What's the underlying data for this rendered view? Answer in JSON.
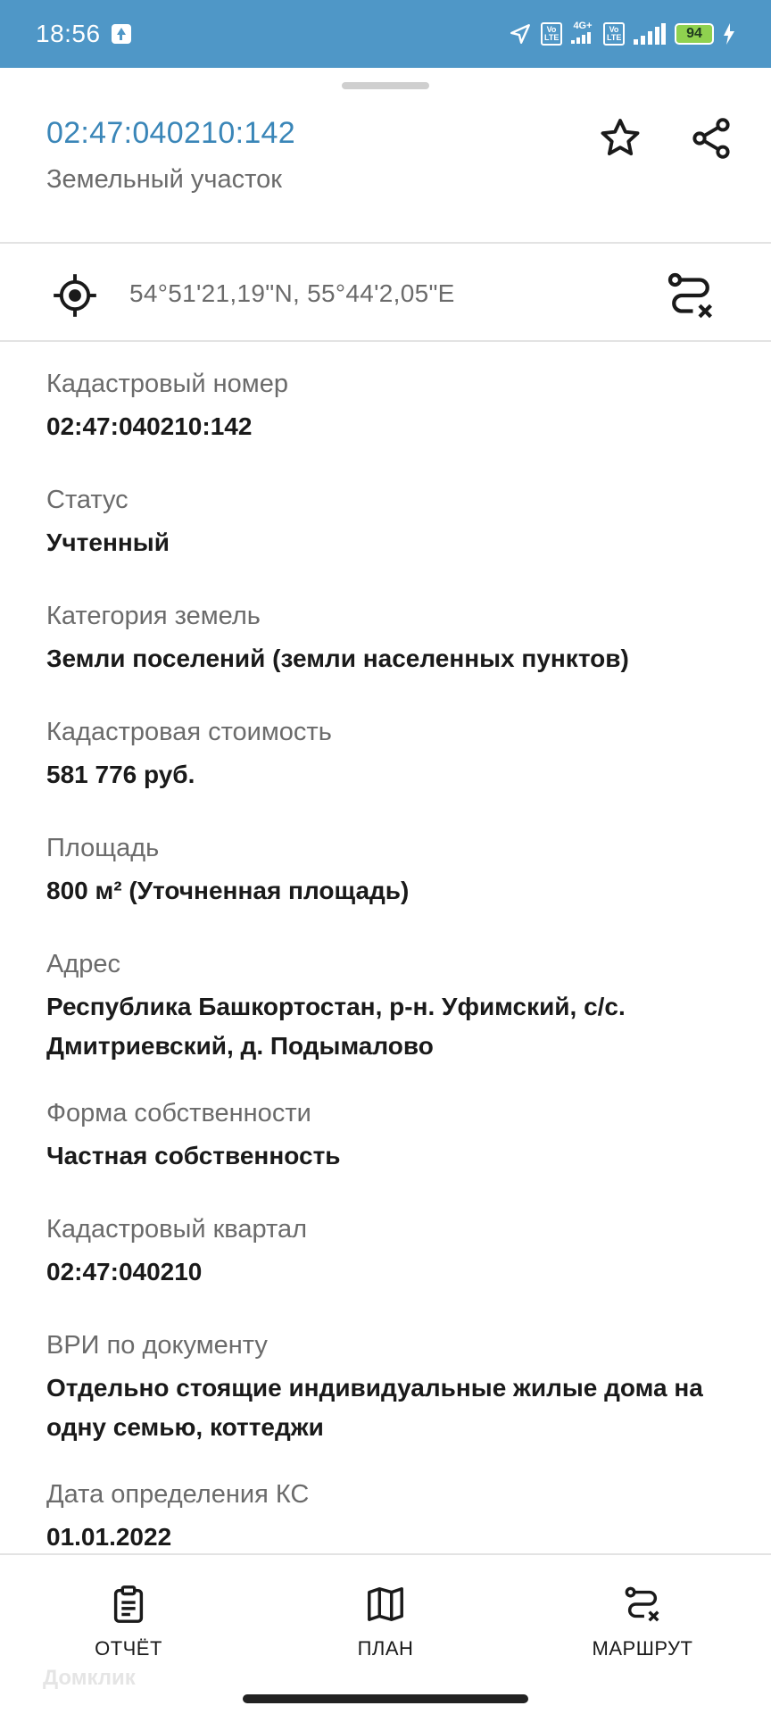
{
  "status_bar": {
    "time": "18:56",
    "network": "4G+",
    "volte1": "Vo LTE",
    "volte2": "Vo LTE",
    "battery": "94"
  },
  "header": {
    "title": "02:47:040210:142",
    "subtitle": "Земельный участок"
  },
  "coordinates": "54°51'21,19\"N, 55°44'2,05\"E",
  "fields": [
    {
      "label": "Кадастровый номер",
      "value": "02:47:040210:142"
    },
    {
      "label": "Статус",
      "value": "Учтенный"
    },
    {
      "label": "Категория земель",
      "value": "Земли поселений (земли населенных пунктов)"
    },
    {
      "label": "Кадастровая стоимость",
      "value": "581 776 руб."
    },
    {
      "label": "Площадь",
      "value": "800 м² (Уточненная площадь)"
    },
    {
      "label": "Адрес",
      "value": "Республика Башкортостан, р-н. Уфимский, с/с. Дмитриевский, д. Подымалово"
    },
    {
      "label": "Форма собственности",
      "value": "Частная собственность"
    },
    {
      "label": "Кадастровый квартал",
      "value": "02:47:040210"
    },
    {
      "label": "ВРИ по документу",
      "value": "Отдельно стоящие индивидуальные жилые дома на одну семью, коттеджи"
    },
    {
      "label": "Дата определения КС",
      "value": "01.01.2022"
    }
  ],
  "tabs": [
    {
      "label": "ОТЧЁТ",
      "icon": "report-icon"
    },
    {
      "label": "ПЛАН",
      "icon": "map-icon"
    },
    {
      "label": "МАРШРУТ",
      "icon": "route-icon"
    }
  ],
  "watermark": "Домклик",
  "colors": {
    "status_bar": "#4f97c7",
    "title": "#3a86b8",
    "label": "#6b6b6b",
    "value": "#1a1a1a"
  }
}
